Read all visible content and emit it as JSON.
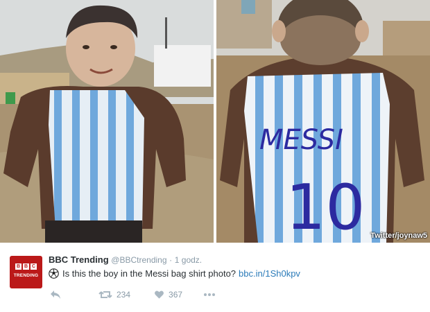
{
  "photos": {
    "left_alt": "",
    "right_alt": "",
    "shirt_text_name": "MESSI",
    "shirt_text_number": "10",
    "watermark": "Twitter/joynaw5"
  },
  "tweet": {
    "avatar_logo": "BBC",
    "avatar_sub": "TRENDING",
    "name": "BBC Trending",
    "handle": "@BBCtrending",
    "separator": "·",
    "time": "1 godz.",
    "emoji_icon": "soccer-ball-icon",
    "text": "Is this the boy in the Messi bag shirt photo?",
    "link": "bbc.in/1Sh0kpv",
    "actions": {
      "reply_icon": "reply-icon",
      "retweet_icon": "retweet-icon",
      "retweet_count": "234",
      "like_icon": "heart-icon",
      "like_count": "367",
      "more_icon": "more-dots-icon"
    }
  },
  "colors": {
    "bbc_red": "#bb1919",
    "link_blue": "#2b7bb9",
    "muted_gray": "#8899a6",
    "jersey_blue": "#6fa8dc"
  }
}
